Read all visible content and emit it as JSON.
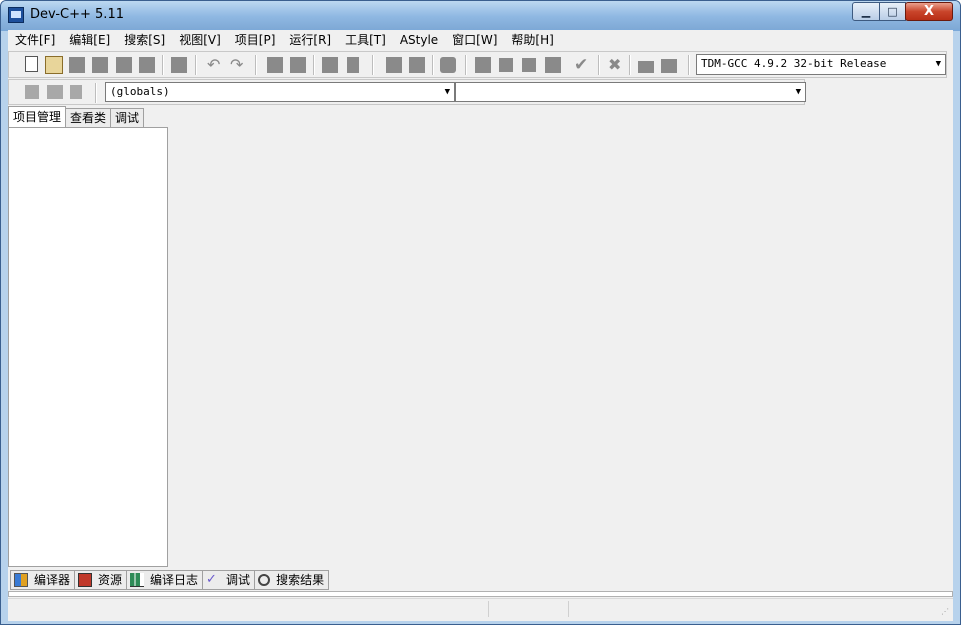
{
  "window": {
    "title": "Dev-C++ 5.11",
    "min_icon": "minimize-icon",
    "max_icon": "maximize-icon",
    "close_icon": "close-icon",
    "min_glyph": "▁",
    "max_glyph": "□",
    "close_glyph": "X"
  },
  "menubar": {
    "items": [
      "文件[F]",
      "编辑[E]",
      "搜索[S]",
      "视图[V]",
      "项目[P]",
      "运行[R]",
      "工具[T]",
      "AStyle",
      "窗口[W]",
      "帮助[H]"
    ]
  },
  "toolbar": {
    "compiler": "TDM-GCC 4.9.2 32-bit Release",
    "dropdown_glyph": "▼"
  },
  "toolbar2": {
    "scope": "(globals)",
    "member": ""
  },
  "left_panel": {
    "tabs": [
      "项目管理",
      "查看类",
      "调试"
    ],
    "active_tab": "项目管理"
  },
  "bottom_tabs": [
    {
      "label": "编译器",
      "icon": "grid-icon"
    },
    {
      "label": "资源",
      "icon": "resources-icon"
    },
    {
      "label": "编译日志",
      "icon": "bar-chart-icon"
    },
    {
      "label": "调试",
      "icon": "check-icon"
    },
    {
      "label": "搜索结果",
      "icon": "magnifier-icon"
    }
  ]
}
